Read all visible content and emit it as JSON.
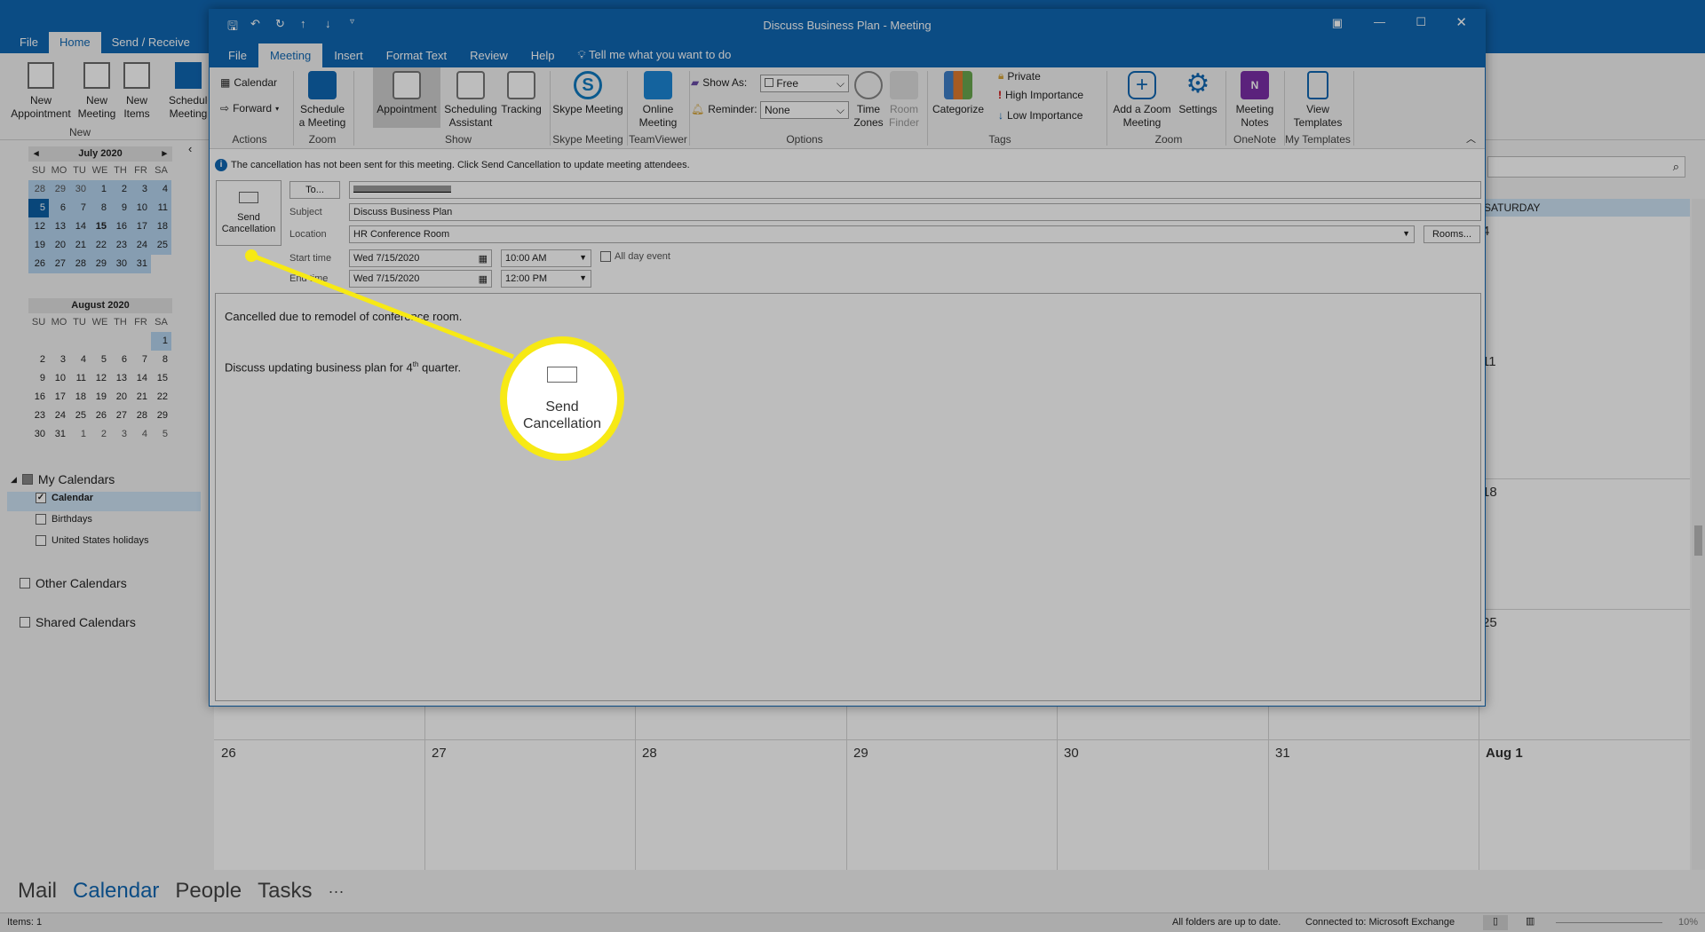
{
  "main": {
    "tabs": [
      "File",
      "Home",
      "Send / Receive"
    ],
    "active_tab": "Home",
    "ribbon": {
      "new_appointment": "New Appointment",
      "new_meeting": "New Meeting",
      "new_items": "New Items",
      "schedule_meeting": "Schedule Meeting",
      "group_new": "New"
    },
    "months": [
      {
        "title": "July 2020",
        "days": [
          "28",
          "29",
          "30",
          "1",
          "2",
          "3",
          "4",
          "5",
          "6",
          "7",
          "8",
          "9",
          "10",
          "11",
          "12",
          "13",
          "14",
          "15",
          "16",
          "17",
          "18",
          "19",
          "20",
          "21",
          "22",
          "23",
          "24",
          "25",
          "26",
          "27",
          "28",
          "29",
          "30",
          "31"
        ],
        "today": "5",
        "bold": "15"
      },
      {
        "title": "August 2020",
        "days": [
          "",
          "",
          "",
          "",
          "",
          "",
          "1",
          "2",
          "3",
          "4",
          "5",
          "6",
          "7",
          "8",
          "9",
          "10",
          "11",
          "12",
          "13",
          "14",
          "15",
          "16",
          "17",
          "18",
          "19",
          "20",
          "21",
          "22",
          "23",
          "24",
          "25",
          "26",
          "27",
          "28",
          "29",
          "30",
          "31",
          "1",
          "2",
          "3",
          "4",
          "5"
        ]
      }
    ],
    "dow": [
      "SU",
      "MO",
      "TU",
      "WE",
      "TH",
      "FR",
      "SA"
    ],
    "my_calendars": "My Calendars",
    "calendars": [
      {
        "label": "Calendar",
        "checked": true
      },
      {
        "label": "Birthdays",
        "checked": false
      },
      {
        "label": "United States holidays",
        "checked": false
      }
    ],
    "other_calendars": "Other Calendars",
    "shared_calendars": "Shared Calendars",
    "grid": {
      "saturday_header": "SATURDAY",
      "sat_days": [
        "4",
        "11",
        "18",
        "25"
      ],
      "last_row": [
        "26",
        "27",
        "28",
        "29",
        "30",
        "31",
        "Aug 1"
      ]
    },
    "bottom_nav": [
      "Mail",
      "Calendar",
      "People",
      "Tasks",
      "···"
    ],
    "active_nav": "Calendar",
    "status": {
      "items": "Items: 1",
      "sync": "All folders are up to date.",
      "connection": "Connected to: Microsoft Exchange",
      "zoom": "10%"
    }
  },
  "meeting": {
    "title": "Discuss Business Plan  -  Meeting",
    "tabs": [
      "File",
      "Meeting",
      "Insert",
      "Format Text",
      "Review",
      "Help"
    ],
    "active_tab": "Meeting",
    "tell_me": "Tell me what you want to do",
    "ribbon": {
      "calendar": "Calendar",
      "forward": "Forward",
      "actions": "Actions",
      "schedule": "Schedule a Meeting",
      "zoom_group": "Zoom",
      "appointment": "Appointment",
      "scheduling": "Scheduling Assistant",
      "tracking": "Tracking",
      "show": "Show",
      "skype": "Skype Meeting",
      "skype_group": "Skype Meeting",
      "online": "Online Meeting",
      "teamviewer": "TeamViewer",
      "show_as_label": "Show As:",
      "show_as": "Free",
      "reminder_label": "Reminder:",
      "reminder": "None",
      "time_zones": "Time Zones",
      "room_finder": "Room Finder",
      "options": "Options",
      "categorize": "Categorize",
      "private": "Private",
      "high": "High Importance",
      "low": "Low Importance",
      "tags": "Tags",
      "add_zoom": "Add a Zoom Meeting",
      "settings": "Settings",
      "zoom_group2": "Zoom",
      "notes": "Meeting Notes",
      "onenote": "OneNote",
      "templates": "View Templates",
      "my_templates": "My Templates"
    },
    "info": "The cancellation has not been sent for this meeting. Click Send Cancellation to update meeting attendees.",
    "send_cancellation": "Send Cancellation",
    "to_button": "To...",
    "subject_label": "Subject",
    "subject": "Discuss Business Plan",
    "location_label": "Location",
    "location": "HR Conference Room",
    "rooms": "Rooms...",
    "start_label": "Start time",
    "start_date": "Wed 7/15/2020",
    "start_time": "10:00 AM",
    "all_day": "All day event",
    "end_label": "End time",
    "end_date": "Wed 7/15/2020",
    "end_time": "12:00 PM",
    "body_line1": "Cancelled due to remodel of conference room.",
    "body_line2_pre": "Discuss updating business plan for 4",
    "body_sup": "th",
    "body_line2_post": " quarter."
  },
  "callout": {
    "label": "Send Cancellation",
    "color": "#f7e914"
  },
  "colors": {
    "accent": "#1067b3"
  }
}
